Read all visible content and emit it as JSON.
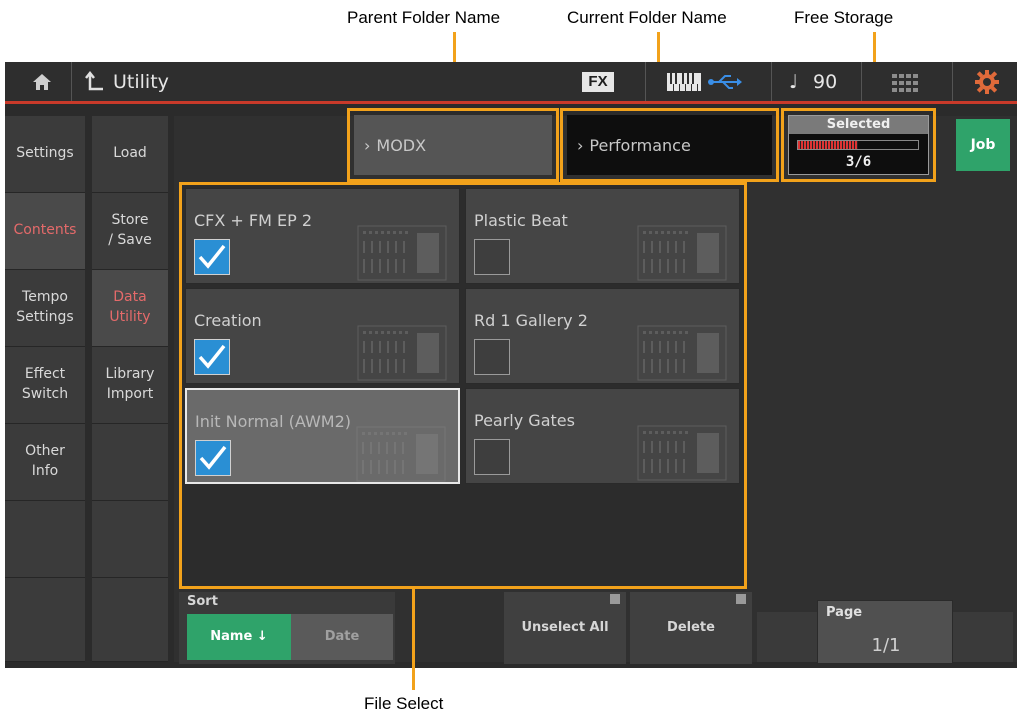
{
  "callouts": {
    "parent_folder": "Parent Folder Name",
    "current_folder": "Current Folder Name",
    "free_storage": "Free Storage",
    "file_select": "File Select"
  },
  "topbar": {
    "title": "Utility",
    "fx": "FX",
    "tempo_symbol": "♩",
    "tempo": "90"
  },
  "left_tabs": [
    {
      "label": "Settings",
      "active": false
    },
    {
      "label": "Contents",
      "active": true
    },
    {
      "label": "Tempo\nSettings",
      "active": false
    },
    {
      "label": "Effect\nSwitch",
      "active": false
    },
    {
      "label": "Other\nInfo",
      "active": false
    }
  ],
  "sub_tabs": [
    {
      "label": "Load",
      "active": false
    },
    {
      "label": "Store\n/ Save",
      "active": false
    },
    {
      "label": "Data\nUtility",
      "active": true
    },
    {
      "label": "Library\nImport",
      "active": false
    }
  ],
  "folders": {
    "parent": "MODX",
    "current": "Performance"
  },
  "storage": {
    "label": "Selected",
    "value": "3/6",
    "fill_fraction": 0.5
  },
  "job_button": "Job",
  "files": [
    {
      "name": "CFX + FM EP 2",
      "checked": true,
      "selected": false
    },
    {
      "name": "Plastic Beat",
      "checked": false,
      "selected": false
    },
    {
      "name": "Creation",
      "checked": true,
      "selected": false
    },
    {
      "name": "Rd 1 Gallery 2",
      "checked": false,
      "selected": false
    },
    {
      "name": "Init Normal (AWM2)",
      "checked": true,
      "selected": true
    },
    {
      "name": "Pearly Gates",
      "checked": false,
      "selected": false
    }
  ],
  "sort": {
    "label": "Sort",
    "name_btn": "Name ↓",
    "date_btn": "Date"
  },
  "unselect_all": "Unselect All",
  "delete": "Delete",
  "page": {
    "label": "Page",
    "value": "1/1"
  },
  "colors": {
    "orange_accent": "#f2a21b",
    "red_line": "#c93a2a",
    "green_job": "#2fa36a",
    "checkbox_blue": "#2a8fd4",
    "active_tab_text": "#e46a6a"
  }
}
